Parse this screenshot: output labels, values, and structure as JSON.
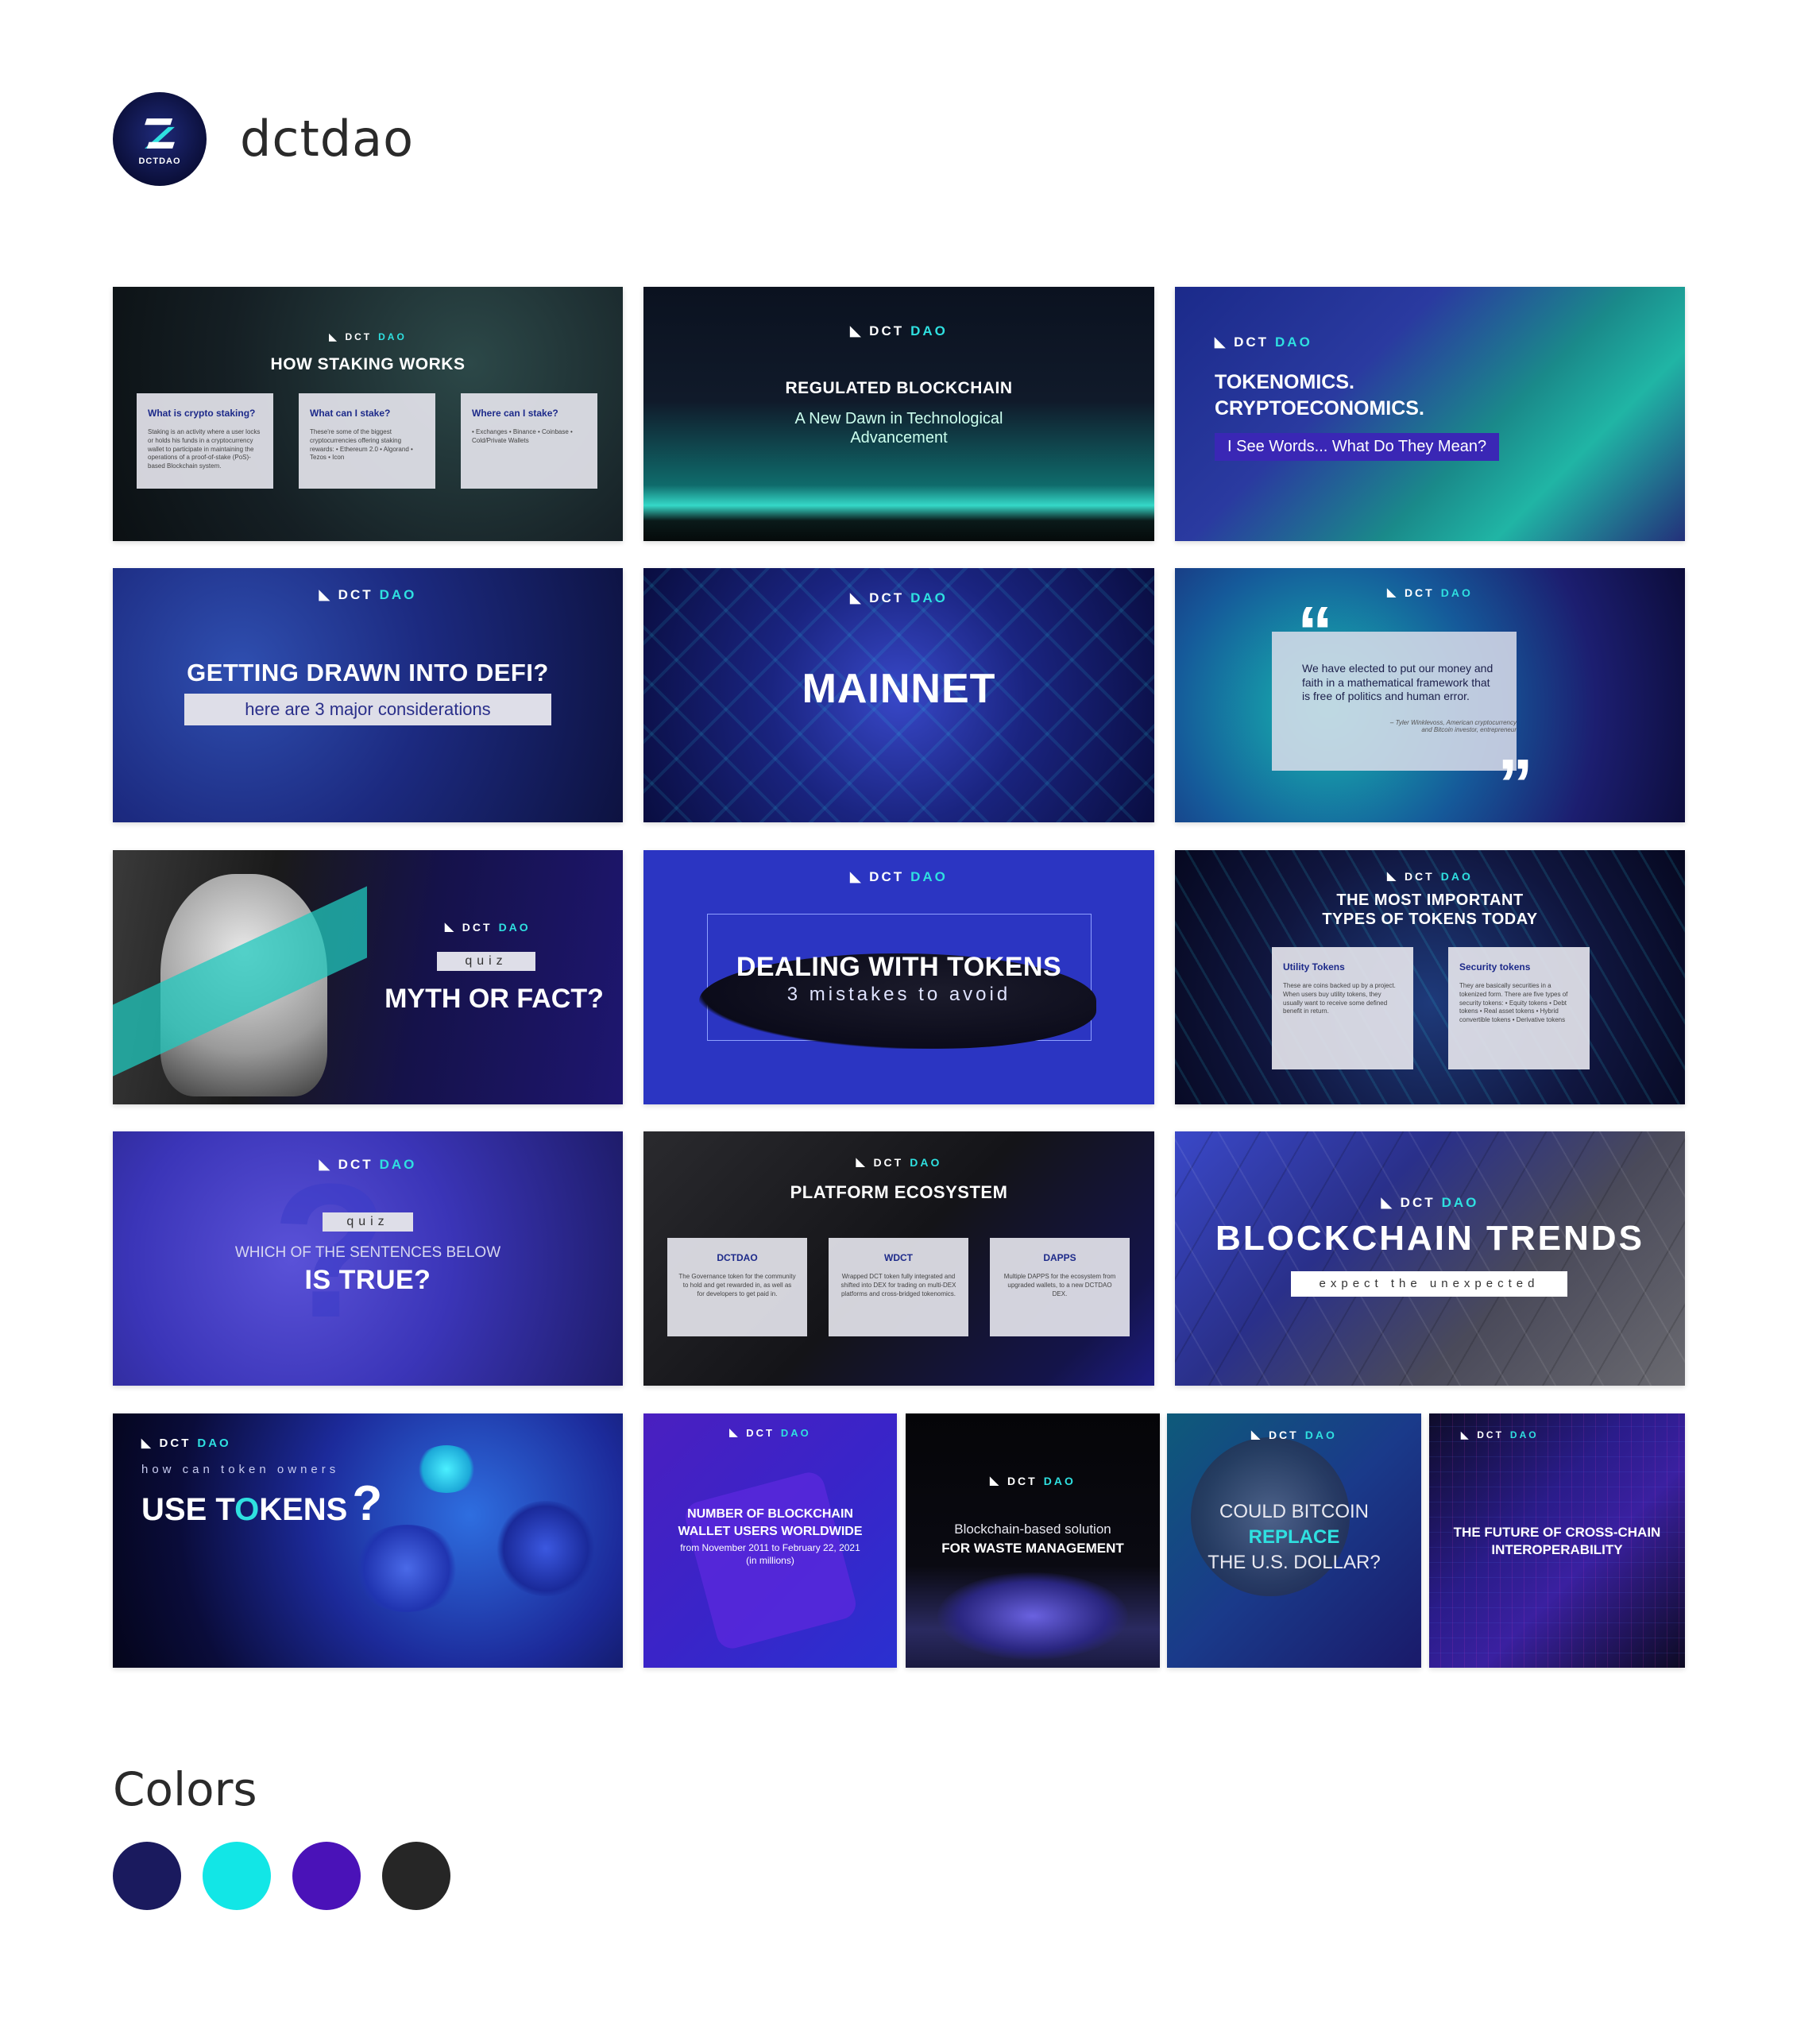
{
  "profile": {
    "name": "dctdao",
    "avatar_text": "DCTDAO"
  },
  "logo": {
    "dct": "DCT",
    "dao": "DAO"
  },
  "cards": {
    "staking": {
      "title": "HOW STAKING WORKS",
      "boxes": [
        {
          "heading": "What is crypto staking?",
          "body": "Staking is an activity where a user locks or holds his funds in a cryptocurrency wallet to participate in maintaining the operations of a proof-of-stake (PoS)-based Blockchain system."
        },
        {
          "heading": "What can I stake?",
          "body": "These're some of the biggest cryptocurrencies offering staking rewards: • Ethereum 2.0 • Algorand • Tezos • Icon"
        },
        {
          "heading": "Where can I stake?",
          "body": "• Exchanges • Binance • Coinbase • Cold/Private Wallets"
        }
      ]
    },
    "regulated": {
      "title": "REGULATED BLOCKCHAIN",
      "subtitle": "A New Dawn in Technological Advancement"
    },
    "tokenomics": {
      "line1": "TOKENOMICS.",
      "line2": "CRYPTOECONOMICS.",
      "tag": "I See Words... What Do They Mean?"
    },
    "defi": {
      "title": "GETTING DRAWN INTO DEFI?",
      "tag": "here are 3 major considerations"
    },
    "mainnet": {
      "title": "MAINNET"
    },
    "quote": {
      "open": "“",
      "close": "”",
      "text": "We have elected to put our money and faith in a mathematical framework that is free of politics and human error.",
      "author": "– Tyler Winklevoss, American cryptocurrency and Bitcoin investor, entrepreneur"
    },
    "myth": {
      "tag": "quiz",
      "title": "MYTH OR FACT?"
    },
    "dealing": {
      "title": "DEALING WITH TOKENS",
      "subtitle": "3 mistakes to avoid"
    },
    "types": {
      "title1": "THE MOST IMPORTANT",
      "title2": "TYPES OF TOKENS TODAY",
      "boxes": [
        {
          "heading": "Utility Tokens",
          "body": "These are coins backed up by a project. When users buy utility tokens, they usually want to receive some defined benefit in return."
        },
        {
          "heading": "Security tokens",
          "body": "They are basically securities in a tokenized form. There are five types of security tokens: • Equity tokens • Debt tokens • Real asset tokens • Hybrid convertible tokens • Derivative tokens"
        }
      ]
    },
    "quiz2": {
      "tag": "quiz",
      "line1": "WHICH OF THE SENTENCES BELOW",
      "line2": "IS TRUE?"
    },
    "platform": {
      "title": "PLATFORM ECOSYSTEM",
      "boxes": [
        {
          "heading": "DCTDAO",
          "body": "The Governance token for the community to hold and get rewarded in, as well as for developers to get paid in."
        },
        {
          "heading": "WDCT",
          "body": "Wrapped DCT token fully integrated and shifted into DEX for trading on multi-DEX platforms and cross-bridged tokenomics."
        },
        {
          "heading": "DAPPS",
          "body": "Multiple DAPPS for the ecosystem from upgraded wallets, to a new DCTDAO DEX."
        }
      ]
    },
    "trends": {
      "title": "BLOCKCHAIN TRENDS",
      "tag": "expect the unexpected"
    },
    "use": {
      "pre": "how can token owners",
      "title_a": "USE T",
      "title_o": "O",
      "title_b": "KENS",
      "q": "?"
    },
    "wallet": {
      "line1": "NUMBER OF BLOCKCHAIN",
      "line2": "WALLET USERS WORLDWIDE",
      "line3": "from November 2011 to February 22, 2021",
      "line4": "(in millions)"
    },
    "waste": {
      "line1": "Blockchain-based solution",
      "line2": "FOR WASTE MANAGEMENT"
    },
    "bitcoin": {
      "line1": "COULD BITCOIN",
      "line2": "REPLACE",
      "line3": "THE U.S. DOLLAR?"
    },
    "future": {
      "line1": "THE FUTURE OF CROSS-CHAIN",
      "line2": "INTEROPERABILITY"
    }
  },
  "colors_section": {
    "title": "Colors",
    "swatches": [
      "#1a1a5e",
      "#12e6e6",
      "#4a12b8",
      "#262626"
    ]
  }
}
